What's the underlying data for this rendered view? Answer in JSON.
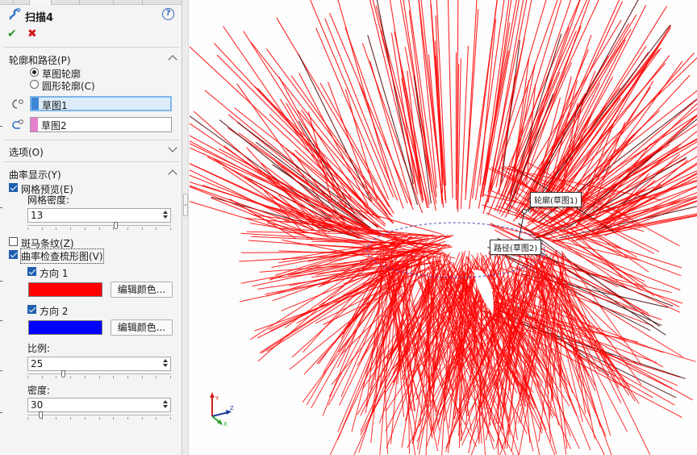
{
  "feature": {
    "title": "扫描4",
    "help_label": "?",
    "ok_glyph": "✔",
    "cancel_glyph": "✖"
  },
  "profile_path": {
    "header": "轮廓和路径(P)",
    "radio_sketch_profile": "草图轮廓",
    "radio_circular_profile": "圆形轮廓(C)",
    "profile_selection": "草图1",
    "path_selection": "草图2",
    "profile_color": "#3e87d6",
    "path_color": "#e87fcf"
  },
  "options": {
    "header": "选项(O)"
  },
  "curvature": {
    "header": "曲率显示(Y)",
    "mesh_preview_label": "网格预览(E)",
    "mesh_density_label": "网格密度:",
    "mesh_density_value": "13",
    "mesh_density_fraction": 0.62,
    "zebra_label": "斑马条纹(Z)",
    "comb_label": "曲率检查梳形图(V)",
    "dir1_label": "方向 1",
    "dir1_color": "#ff0000",
    "dir1_button": "编辑颜色...",
    "dir2_label": "方向 2",
    "dir2_color": "#0000ff",
    "dir2_button": "编辑颜色...",
    "scale_label": "比例:",
    "scale_value": "25",
    "scale_fraction": 0.24,
    "density_label": "密度:",
    "density_value": "30",
    "density_fraction": 0.08
  },
  "viewport": {
    "callout_profile": "轮廓(草图1)",
    "callout_path": "路径(草图2)",
    "comb_color": "#ff0000",
    "axis_x": "X",
    "axis_y": "Y",
    "axis_z": "Z"
  }
}
